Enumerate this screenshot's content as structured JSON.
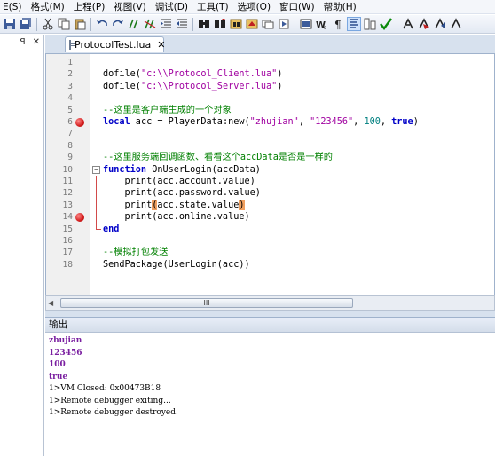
{
  "menu": [
    "E(S)",
    "格式(M)",
    "上程(P)",
    "视图(V)",
    "调试(D)",
    "工具(T)",
    "选项(O)",
    "窗口(W)",
    "帮助(H)"
  ],
  "left_panel": {
    "pin": "ꟼ",
    "close": "✕"
  },
  "tab": {
    "title": "ProtocolTest.lua",
    "close": "✕"
  },
  "code_lines": [
    {
      "n": "1",
      "parts": []
    },
    {
      "n": "2",
      "parts": [
        [
          "fn",
          "dofile("
        ],
        [
          "str",
          "\"c:\\\\Protocol_Client.lua\""
        ],
        [
          "fn",
          ")"
        ]
      ]
    },
    {
      "n": "3",
      "parts": [
        [
          "fn",
          "dofile("
        ],
        [
          "str",
          "\"c:\\\\Protocol_Server.lua\""
        ],
        [
          "fn",
          ")"
        ]
      ]
    },
    {
      "n": "4",
      "parts": []
    },
    {
      "n": "5",
      "parts": [
        [
          "cm",
          "--这里是客户端生成的一个对象"
        ]
      ]
    },
    {
      "n": "6",
      "parts": [
        [
          "kw",
          "local"
        ],
        [
          "fn",
          " acc = PlayerData:new("
        ],
        [
          "str",
          "\"zhujian\""
        ],
        [
          "fn",
          ", "
        ],
        [
          "str",
          "\"123456\""
        ],
        [
          "fn",
          ", "
        ],
        [
          "num",
          "100"
        ],
        [
          "fn",
          ", "
        ],
        [
          "kw",
          "true"
        ],
        [
          "fn",
          ")"
        ]
      ]
    },
    {
      "n": "7",
      "parts": []
    },
    {
      "n": "8",
      "parts": []
    },
    {
      "n": "9",
      "parts": [
        [
          "cm",
          "--这里服务端回调函数、看看这个accData是否是一样的"
        ]
      ]
    },
    {
      "n": "10",
      "parts": [
        [
          "kw",
          "function"
        ],
        [
          "fn",
          " OnUserLogin(accData)"
        ]
      ]
    },
    {
      "n": "11",
      "parts": [
        [
          "fn",
          "    print(acc.account.value)"
        ]
      ]
    },
    {
      "n": "12",
      "parts": [
        [
          "fn",
          "    print(acc.password.value)"
        ]
      ]
    },
    {
      "n": "13",
      "parts": [
        [
          "fn",
          "    print"
        ],
        [
          "hl",
          "("
        ],
        [
          "fn",
          "acc.state.value"
        ],
        [
          "hl",
          ")"
        ]
      ]
    },
    {
      "n": "14",
      "parts": [
        [
          "fn",
          "    print(acc.online.value)"
        ]
      ]
    },
    {
      "n": "15",
      "parts": [
        [
          "kw",
          "end"
        ]
      ]
    },
    {
      "n": "16",
      "parts": []
    },
    {
      "n": "17",
      "parts": [
        [
          "cm",
          "--模拟打包发送"
        ]
      ]
    },
    {
      "n": "18",
      "parts": [
        [
          "fn",
          "SendPackage(UserLogin(acc))"
        ]
      ]
    }
  ],
  "breakpoints": [
    "6",
    "14"
  ],
  "scroll_thumb": "III",
  "output": {
    "title": "输出",
    "lines": [
      {
        "text": "zhujian",
        "style": "purple"
      },
      {
        "text": "123456",
        "style": "purple"
      },
      {
        "text": "100",
        "style": "purple"
      },
      {
        "text": "true",
        "style": "purple"
      },
      {
        "text": "1>VM Closed: 0x00473B18",
        "style": "plain"
      },
      {
        "text": "1>Remote debugger exiting...",
        "style": "plain"
      },
      {
        "text": "1>Remote debugger destroyed.",
        "style": "plain"
      }
    ]
  }
}
